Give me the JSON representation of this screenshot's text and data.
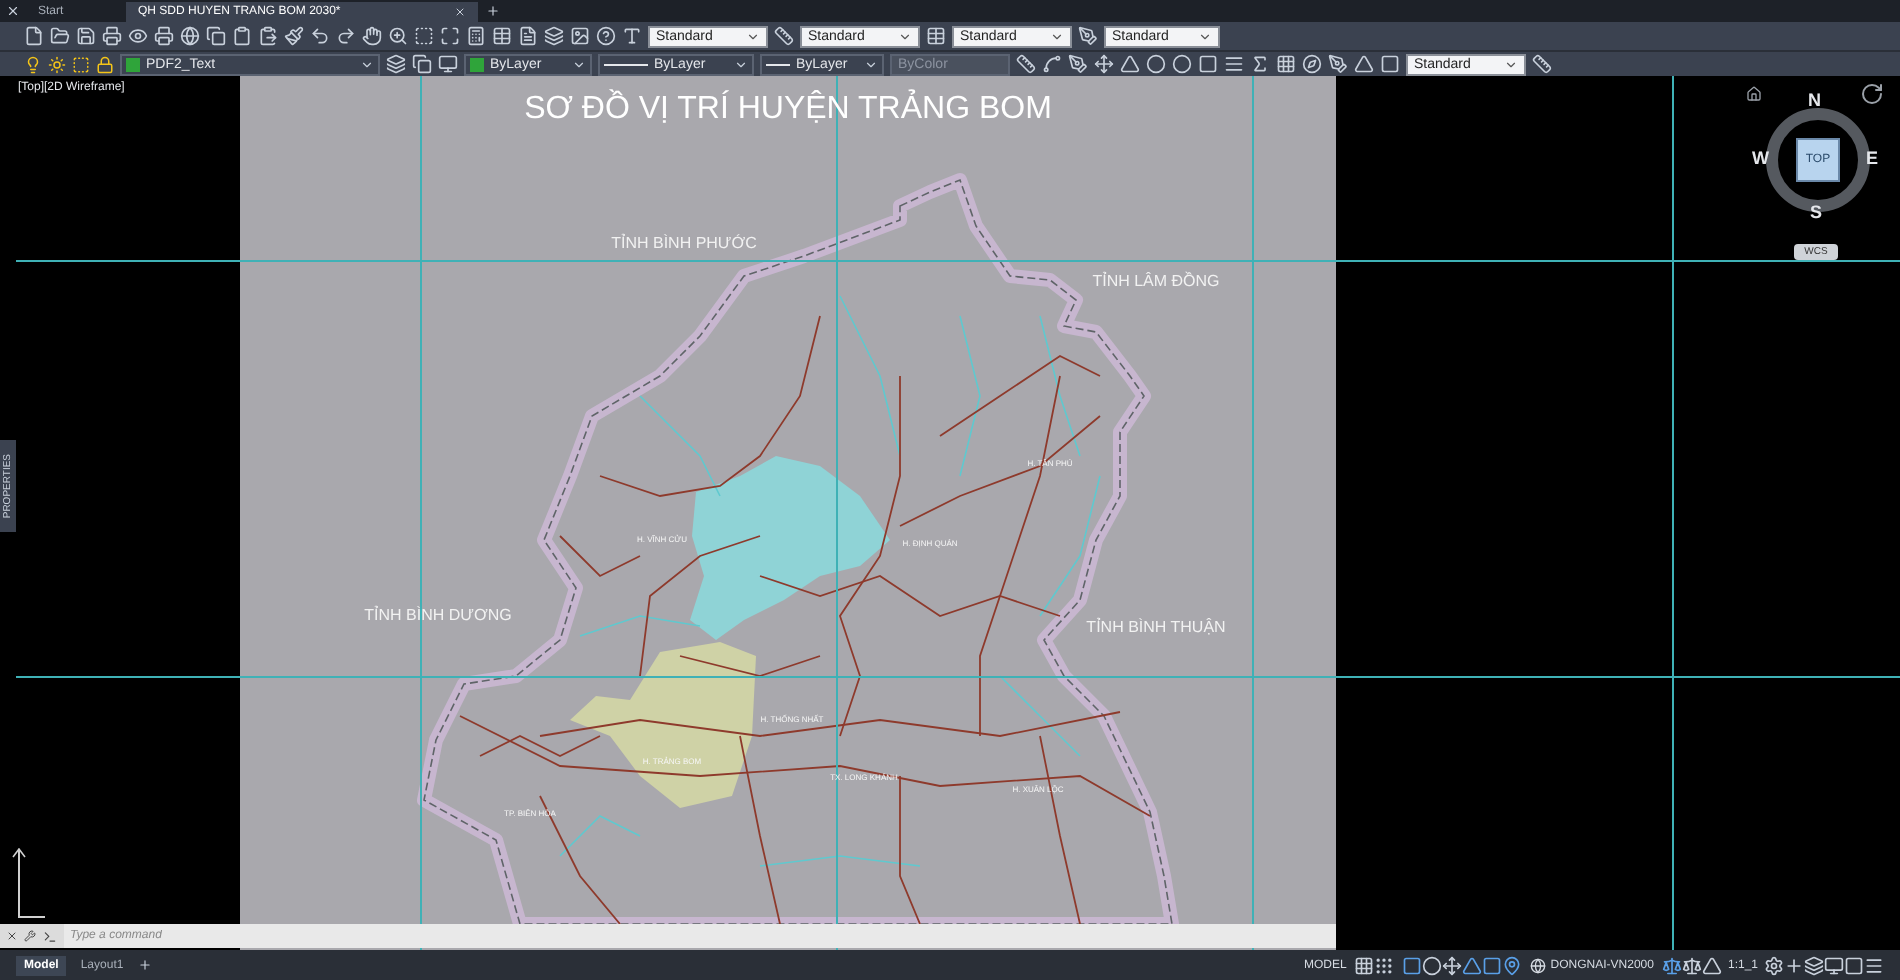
{
  "tabs": [
    {
      "label": "Start",
      "selected": false
    },
    {
      "label": "QH SDD HUYEN TRANG BOM 2030*",
      "selected": true
    }
  ],
  "toolbar_1": {
    "dropdowns": [
      "Standard",
      "Standard",
      "Standard",
      "Standard"
    ]
  },
  "toolbar_2": {
    "layer": "PDF2_Text",
    "color_setting": "ByLayer",
    "linetype": "ByLayer",
    "lineweight": "ByLayer",
    "plot_style": {
      "value": "ByColor",
      "disabled": true
    },
    "dim_style": "Standard"
  },
  "viewport": {
    "label": "[Top][2D Wireframe]"
  },
  "palette_tab": "PROPERTIES",
  "map": {
    "title": "SƠ ĐỒ VỊ TRÍ HUYỆN TRẢNG BOM",
    "labels": [
      {
        "text": "TỈNH BÌNH PHƯỚC",
        "kind": "province"
      },
      {
        "text": "TỈNH LÂM ĐỒNG",
        "kind": "province"
      },
      {
        "text": "TỈNH BÌNH DƯƠNG",
        "kind": "province"
      },
      {
        "text": "TỈNH BÌNH THUẬN",
        "kind": "province"
      },
      {
        "text": "H. TÂN PHÚ",
        "kind": "district"
      },
      {
        "text": "H. VĨNH CỬU",
        "kind": "district"
      },
      {
        "text": "H. ĐỊNH QUÁN",
        "kind": "district"
      },
      {
        "text": "H. THỐNG NHẤT",
        "kind": "district"
      },
      {
        "text": "H. TRẢNG BOM",
        "kind": "district"
      },
      {
        "text": "TX. LONG KHÁNH",
        "kind": "district"
      },
      {
        "text": "H. XUÂN LỘC",
        "kind": "district"
      },
      {
        "text": "TP. BIÊN HÒA",
        "kind": "district"
      }
    ]
  },
  "viewcube": {
    "north": "N",
    "south": "S",
    "east": "E",
    "west": "W",
    "face": "TOP",
    "ucs": "WCS"
  },
  "command_line": {
    "placeholder": "Type a command"
  },
  "layout_tabs": [
    {
      "label": "Model",
      "selected": true
    },
    {
      "label": "Layout1",
      "selected": false
    }
  ],
  "status_bar": {
    "space": "MODEL",
    "coordinate_system": "DONGNAI-VN2000",
    "annotation_scale": "1:1_1"
  }
}
